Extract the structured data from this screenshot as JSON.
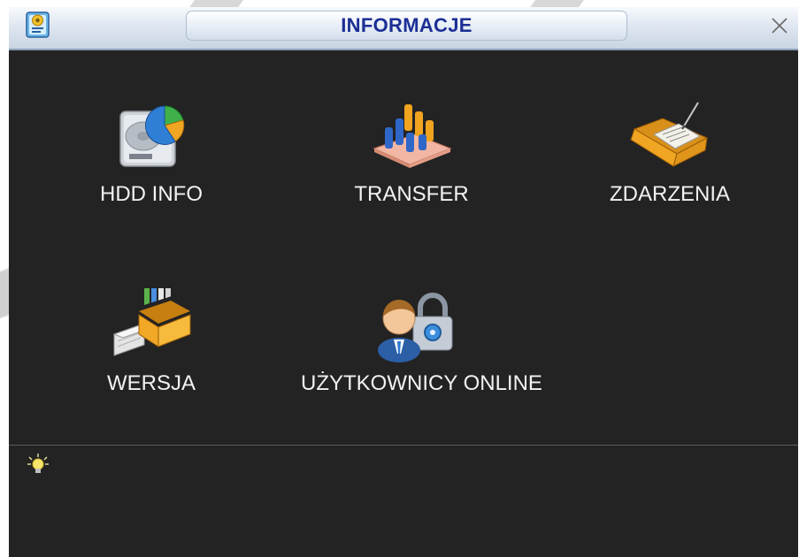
{
  "window": {
    "title": "INFORMACJE"
  },
  "menu": {
    "items": [
      {
        "label": "HDD INFO",
        "icon": "hdd-chart-icon"
      },
      {
        "label": "TRANSFER",
        "icon": "bar-chart-icon"
      },
      {
        "label": "ZDARZENIA",
        "icon": "log-folder-icon"
      },
      {
        "label": "WERSJA",
        "icon": "file-drawer-icon"
      },
      {
        "label": "UŻYTKOWNICY ONLINE",
        "icon": "user-lock-icon"
      }
    ]
  },
  "status": {
    "icon": "lightbulb-icon"
  },
  "colors": {
    "title_text": "#1c2f95",
    "background": "#232323",
    "label_text": "#f2f2f2"
  }
}
